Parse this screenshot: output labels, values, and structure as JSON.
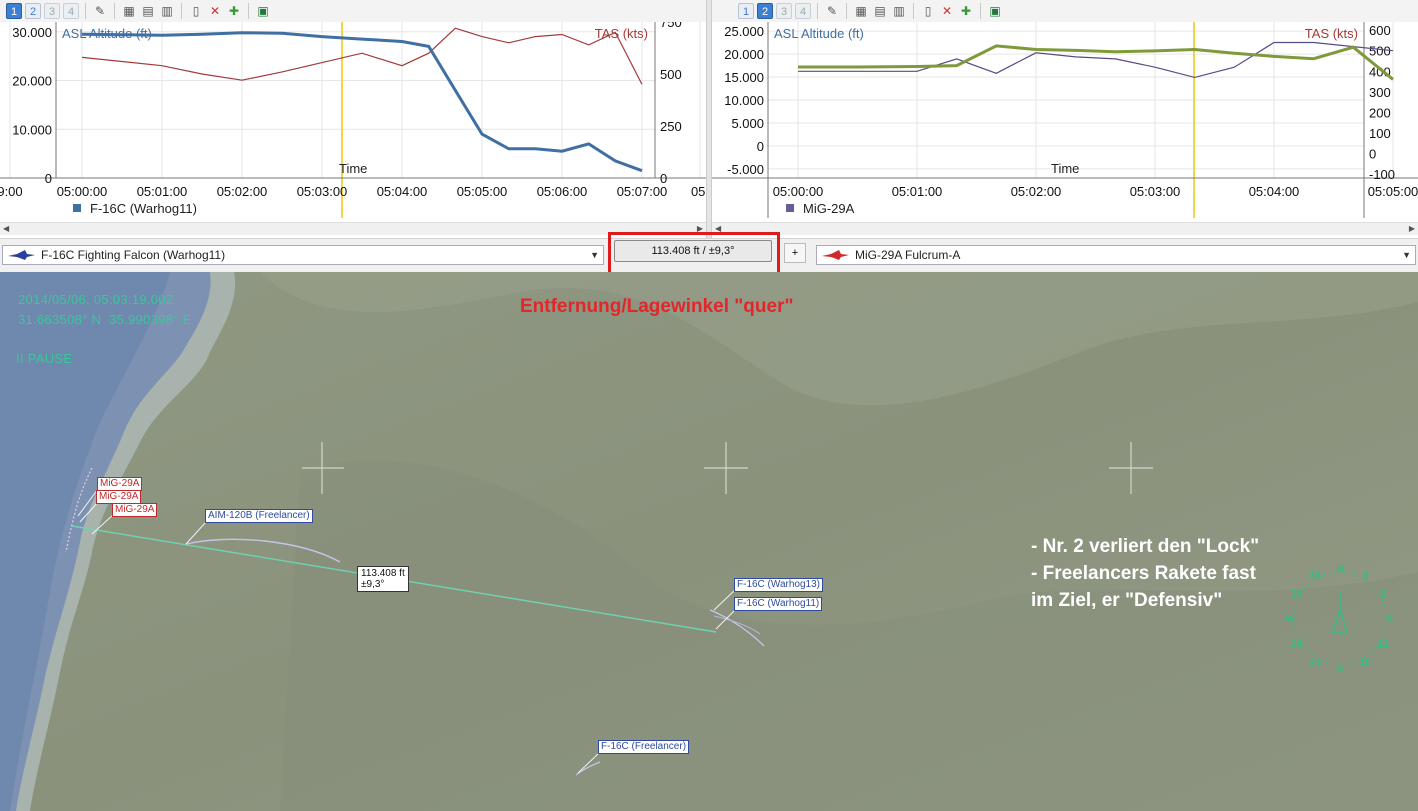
{
  "toolbar_left": {
    "tabs": [
      "1",
      "2",
      "3",
      "4"
    ],
    "active_tab": "1"
  },
  "toolbar_right": {
    "tabs": [
      "1",
      "2",
      "3",
      "4"
    ],
    "active_tab": "2"
  },
  "chart_left": {
    "left_axis_label": "ASL Altitude (ft)",
    "right_axis_label": "TAS (kts)",
    "x_label": "Time",
    "legend": "F-16C (Warhog11)",
    "y_left_ticks": [
      "30.000",
      "20.000",
      "10.000",
      "0"
    ],
    "y_right_ticks": [
      "750",
      "500",
      "250",
      "0"
    ],
    "x_ticks": [
      "9:00",
      "05:00:00",
      "05:01:00",
      "05:02:00",
      "05:03:00",
      "05:04:00",
      "05:05:00",
      "05:06:00",
      "05:07:00",
      "05:"
    ],
    "colors": {
      "altitude": "#3f6fa3",
      "tas": "#a23a3a",
      "cursor": "#f2d64a"
    }
  },
  "chart_right": {
    "left_axis_label": "ASL Altitude (ft)",
    "right_axis_label": "TAS (kts)",
    "x_label": "Time",
    "legend": "MiG-29A",
    "y_left_ticks": [
      "25.000",
      "20.000",
      "15.000",
      "10.000",
      "5.000",
      "0",
      "-5.000"
    ],
    "y_right_ticks": [
      "600",
      "500",
      "400",
      "300",
      "200",
      "100",
      "0",
      "-100"
    ],
    "x_ticks": [
      "05:00:00",
      "05:01:00",
      "05:02:00",
      "05:03:00",
      "05:04:00",
      "05:05:00"
    ],
    "colors": {
      "altitude": "#7e9a3a",
      "tas": "#5a4a86",
      "cursor": "#f2d64a"
    }
  },
  "chart_data": [
    {
      "type": "line",
      "title": "",
      "xlabel": "Time",
      "ylabel": "ASL Altitude (ft)",
      "y2label": "TAS (kts)",
      "x": [
        "05:00:00",
        "05:00:30",
        "05:01:00",
        "05:01:30",
        "05:02:00",
        "05:02:30",
        "05:03:00",
        "05:03:30",
        "05:04:00",
        "05:04:20",
        "05:04:40",
        "05:05:00",
        "05:05:20",
        "05:05:40",
        "05:06:00",
        "05:06:20",
        "05:06:40",
        "05:07:00"
      ],
      "series": [
        {
          "name": "F-16C (Warhog11)",
          "axis": "left",
          "values": [
            29500,
            29400,
            29300,
            29500,
            29800,
            29700,
            29000,
            28500,
            28000,
            27000,
            18000,
            9000,
            6000,
            6000,
            5500,
            7000,
            3500,
            1500
          ]
        },
        {
          "name": "",
          "axis": "right",
          "values": [
            580,
            560,
            540,
            500,
            470,
            510,
            555,
            600,
            540,
            600,
            720,
            680,
            650,
            680,
            690,
            640,
            700,
            450
          ]
        }
      ],
      "ylim": [
        0,
        32000
      ],
      "y2lim": [
        0,
        750
      ]
    },
    {
      "type": "line",
      "title": "",
      "xlabel": "Time",
      "ylabel": "ASL Altitude (ft)",
      "y2label": "TAS (kts)",
      "x": [
        "05:00:00",
        "05:00:30",
        "05:01:00",
        "05:01:20",
        "05:01:40",
        "05:02:00",
        "05:02:20",
        "05:02:40",
        "05:03:00",
        "05:03:20",
        "05:03:40",
        "05:04:00",
        "05:04:20",
        "05:04:40",
        "05:05:00"
      ],
      "series": [
        {
          "name": "MiG-29A",
          "axis": "left",
          "values": [
            17200,
            17200,
            17300,
            17500,
            21800,
            21000,
            20800,
            20500,
            20700,
            21000,
            20200,
            19500,
            19000,
            21500,
            14500
          ]
        },
        {
          "name": "",
          "axis": "right",
          "values": [
            400,
            400,
            400,
            460,
            390,
            490,
            470,
            460,
            420,
            370,
            420,
            540,
            540,
            520,
            500
          ]
        }
      ],
      "ylim": [
        -7000,
        27000
      ],
      "y2lim": [
        -120,
        640
      ]
    }
  ],
  "selectors": {
    "left_aircraft": "F-16C Fighting Falcon (Warhog11)",
    "distance": "113.408 ft / ±9,3°",
    "plus": "+",
    "right_aircraft": "MiG-29A Fulcrum-A"
  },
  "map": {
    "datetime": "2014/05/06, 05:03:19.00Z",
    "coords": "31.663508° N  35.990398° E",
    "pause": "II PAUSE",
    "annotation": "Entfernung/Lagewinkel \"quer\"",
    "notes": [
      "- Nr. 2 verliert den \"Lock\"",
      "- Freelancers Rakete fast",
      "im Ziel, er \"Defensiv\""
    ],
    "labels": {
      "mig_1": "MiG-29A",
      "mig_2": "MiG-29A",
      "mig_3": "MiG-29A",
      "missile": "AIM-120B (Freelancer)",
      "f16_13": "F-16C (Warhog13)",
      "f16_11": "F-16C (Warhog11)",
      "f16_freelancer": "F-16C (Freelancer)"
    },
    "measure": [
      "113.408 ft",
      "±9,3°"
    ],
    "compass": [
      "N",
      "3",
      "6",
      "E",
      "12",
      "15",
      "S",
      "21",
      "24",
      "W",
      "30",
      "33"
    ]
  }
}
